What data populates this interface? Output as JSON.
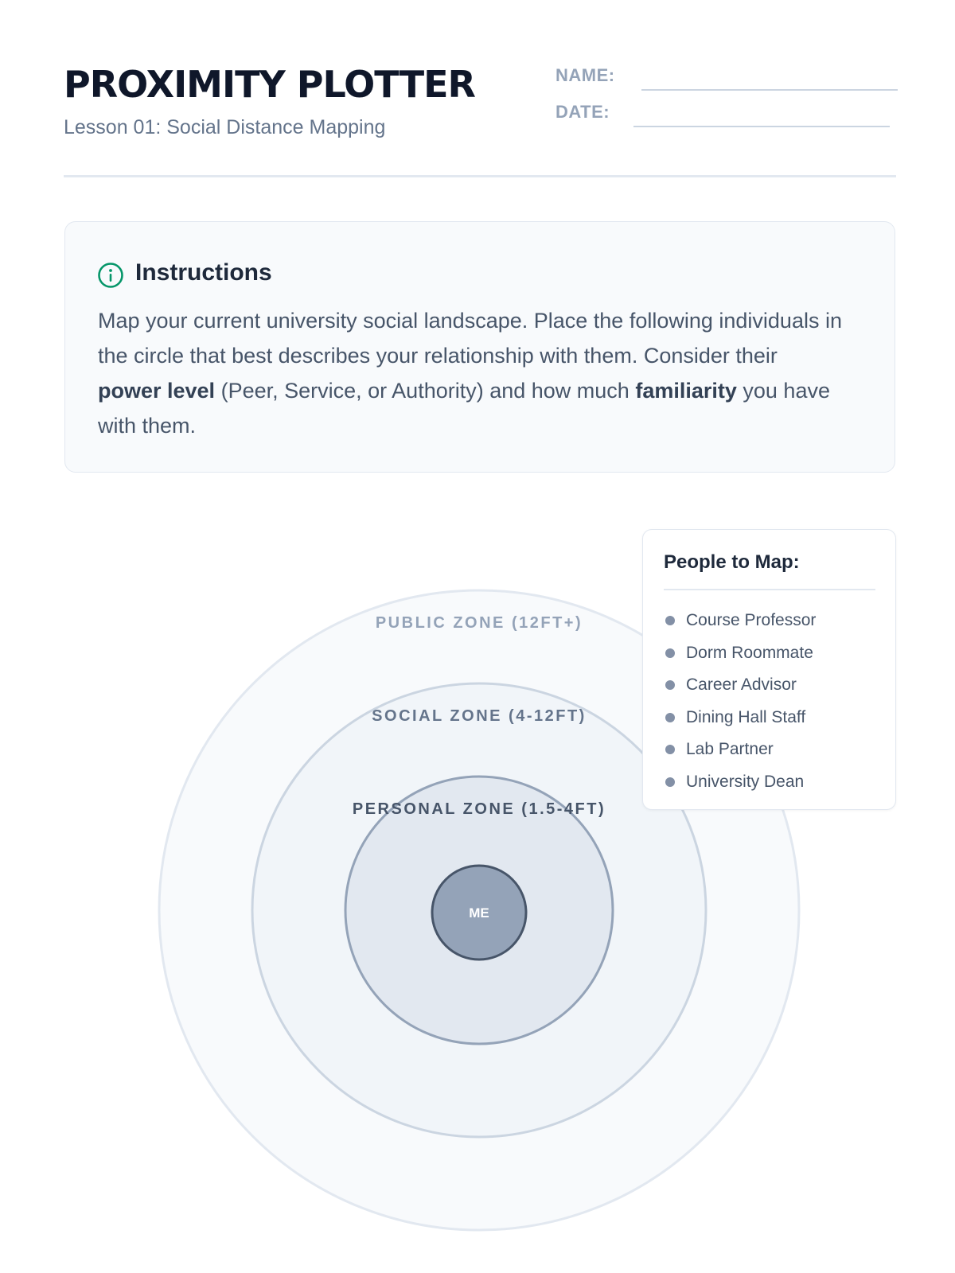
{
  "header": {
    "title": "PROXIMITY PLOTTER",
    "subtitle": "Lesson 01: Social Distance Mapping",
    "name_label": "NAME:",
    "date_label": "DATE:"
  },
  "instructions": {
    "heading": "Instructions",
    "icon": "info-icon",
    "text_1": "Map your current university social landscape. Place the following individuals in the circle that best describes your relationship with them. Consider their ",
    "bold_1": "power level",
    "text_2": " (Peer, Service, or Authority) and how much ",
    "bold_2": "familiarity",
    "text_3": " you have with them."
  },
  "diagram": {
    "zones": [
      {
        "label": "PUBLIC ZONE (12FT+)"
      },
      {
        "label": "SOCIAL ZONE (4-12FT)"
      },
      {
        "label": "PERSONAL ZONE (1.5-4FT)"
      }
    ],
    "center_label": "ME"
  },
  "legend": {
    "title": "People to Map:",
    "items": [
      "Course Professor",
      "Dorm Roommate",
      "Career Advisor",
      "Dining Hall Staff",
      "Lab Partner",
      "University Dean"
    ]
  },
  "colors": {
    "accent": "#059669",
    "title": "#0f172a",
    "muted": "#64748b",
    "zone_public_fill": "#f8fafc",
    "zone_social_fill": "#f1f5f9",
    "zone_personal_fill": "#e2e8f0",
    "center_fill": "#94a3b8",
    "center_stroke": "#475569"
  }
}
